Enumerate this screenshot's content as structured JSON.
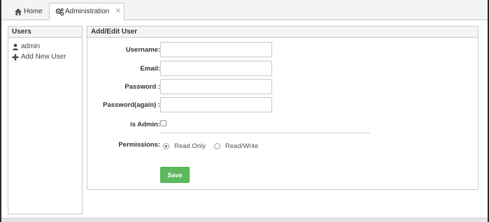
{
  "tabs": [
    {
      "label": "Home",
      "icon": "home-icon"
    },
    {
      "label": "Administration",
      "icon": "gears-icon",
      "active": true,
      "close": "✕"
    }
  ],
  "users_panel": {
    "title": "Users",
    "items": [
      {
        "label": "admin",
        "icon": "user-icon"
      },
      {
        "label": "Add New User",
        "icon": "plus-icon"
      }
    ]
  },
  "form": {
    "title": "Add/Edit User",
    "fields": {
      "username": {
        "label": "Username:",
        "value": ""
      },
      "email": {
        "label": "Email:",
        "value": ""
      },
      "password": {
        "label": "Password :",
        "value": ""
      },
      "password_again": {
        "label": "Password(again) :",
        "value": ""
      }
    },
    "is_admin": {
      "label": "is Admin:",
      "checked": false
    },
    "permissions": {
      "label": "Permissions:",
      "options": [
        {
          "label": "Read Only",
          "checked": true
        },
        {
          "label": "Read/Write",
          "checked": false
        }
      ]
    },
    "save_label": "Save"
  },
  "colors": {
    "save_button": "#5cb85c",
    "window_border": "#2b2b2b",
    "panel_border": "#c9c9c9"
  }
}
